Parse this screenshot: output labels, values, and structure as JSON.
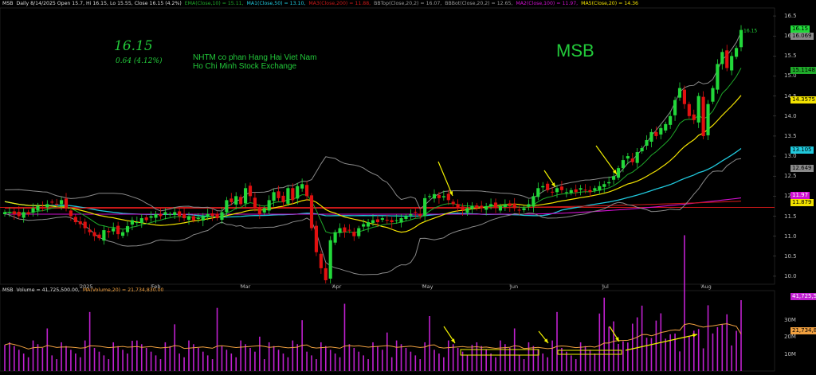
{
  "header": {
    "symbol": "MSB",
    "info": "Daily 8/14/2025 Open 15.7, Hi 16.15, Lo 15.55, Close 16.15 (4.2%)",
    "ema10": "EMA(Close,10) = 15.11,",
    "ma50": "MA1(Close,50) = 13.10,",
    "ma200": "MA3(Close,200) = 11.88,",
    "bbtop": "BBTop(Close,20,2) = 16.07,",
    "bbbot": "BBBot(Close,20,2) = 12.65,",
    "ma100": "MA2(Close,100) = 11.97,",
    "ma20": "MA5(Close,20) = 14.36"
  },
  "overlay": {
    "price": "16.15",
    "change": "0.64 (4.12%)",
    "company_line1": "NHTM co phan Hang Hai Viet Nam",
    "company_line2": "Ho Chi Minh Stock Exchange",
    "symbol_big": "MSB",
    "last_label": "16.15"
  },
  "volume_header": {
    "symbol": "MSB",
    "volume": "Volume = 41,725,500.00,",
    "ma": "MA(Volume,20) = 21,734,830.00"
  },
  "badges": {
    "close": "16.15",
    "bbtop": "16.069",
    "ema10": "15.1148",
    "ma20": "14.3575",
    "ma50": "13.105",
    "bbbot": "12.649",
    "ma100": "11.97",
    "ma200": "11.879",
    "vol": "41,725,5",
    "volma": "21,734,8"
  },
  "colors": {
    "up": "#22d83a",
    "down": "#e01010",
    "ema10": "#1faa2a",
    "ma20": "#f2e200",
    "ma50": "#20c8dc",
    "ma100": "#d010d0",
    "ma200": "#c81818",
    "bb": "#8a8a8a",
    "volume": "#c020d0",
    "volma": "#f0a040",
    "arrow": "#f0f000"
  },
  "chart_data": [
    {
      "type": "candlestick",
      "title": "MSB",
      "y_ticks": [
        "16.5",
        "16.0",
        "15.5",
        "15.0",
        "14.5",
        "14.0",
        "13.5",
        "13.0",
        "12.5",
        "12.0",
        "11.5",
        "11.0",
        "10.5",
        "10.0"
      ],
      "ylim": [
        9.8,
        16.7
      ],
      "x_ticks": [
        "2025",
        "Feb",
        "Mar",
        "Apr",
        "May",
        "Jun",
        "Jul",
        "Aug"
      ],
      "closes": [
        11.6,
        11.6,
        11.55,
        11.5,
        11.6,
        11.55,
        11.7,
        11.75,
        11.7,
        11.8,
        11.85,
        11.8,
        11.9,
        11.7,
        11.5,
        11.35,
        11.3,
        11.2,
        11.1,
        11.0,
        10.95,
        11.15,
        11.1,
        11.2,
        11.05,
        11.1,
        11.25,
        11.4,
        11.35,
        11.45,
        11.4,
        11.5,
        11.55,
        11.5,
        11.6,
        11.55,
        11.6,
        11.5,
        11.45,
        11.5,
        11.4,
        11.45,
        11.5,
        11.55,
        11.5,
        11.45,
        11.6,
        11.9,
        11.85,
        12.0,
        11.8,
        12.2,
        12.0,
        11.7,
        11.55,
        11.7,
        11.9,
        12.1,
        11.95,
        11.85,
        12.2,
        11.9,
        12.25,
        12.3,
        12.0,
        11.2,
        10.6,
        10.2,
        9.9,
        10.9,
        11.1,
        11.2,
        11.1,
        11.15,
        11.0,
        11.2,
        11.3,
        11.35,
        11.4,
        11.35,
        11.45,
        11.4,
        11.35,
        11.4,
        11.45,
        11.5,
        11.55,
        11.6,
        11.5,
        11.95,
        12.0,
        12.05,
        11.95,
        12.0,
        11.9,
        11.8,
        11.7,
        11.65,
        11.7,
        11.75,
        11.7,
        11.7,
        11.75,
        11.8,
        11.7,
        11.75,
        11.8,
        11.75,
        11.7,
        11.65,
        11.7,
        11.8,
        12.0,
        12.2,
        12.25,
        12.15,
        12.1,
        12.2,
        12.15,
        12.1,
        12.15,
        12.1,
        12.2,
        12.15,
        12.1,
        12.2,
        12.25,
        12.3,
        12.35,
        12.5,
        12.7,
        12.9,
        13.0,
        12.85,
        13.1,
        13.2,
        13.4,
        13.6,
        13.5,
        13.7,
        13.8,
        14.0,
        14.4,
        14.7,
        14.3,
        14.0,
        13.9,
        14.5,
        13.5,
        14.3,
        14.7,
        15.3,
        15.6,
        15.2,
        15.5,
        15.7,
        16.15
      ],
      "series": [
        {
          "name": "EMA(Close,10)",
          "last": 15.11
        },
        {
          "name": "MA1(Close,50)",
          "last": 13.1
        },
        {
          "name": "MA3(Close,200)",
          "last": 11.88
        },
        {
          "name": "BBTop(Close,20,2)",
          "last": 16.07
        },
        {
          "name": "BBBot(Close,20,2)",
          "last": 12.65
        },
        {
          "name": "MA2(Close,100)",
          "last": 11.97
        },
        {
          "name": "MA5(Close,20)",
          "last": 14.36
        }
      ]
    },
    {
      "type": "bar",
      "title": "Volume",
      "y_ticks": [
        "30M",
        "20M",
        "10M"
      ],
      "last_volume": 41725500,
      "last_ma20": 21734830
    }
  ]
}
